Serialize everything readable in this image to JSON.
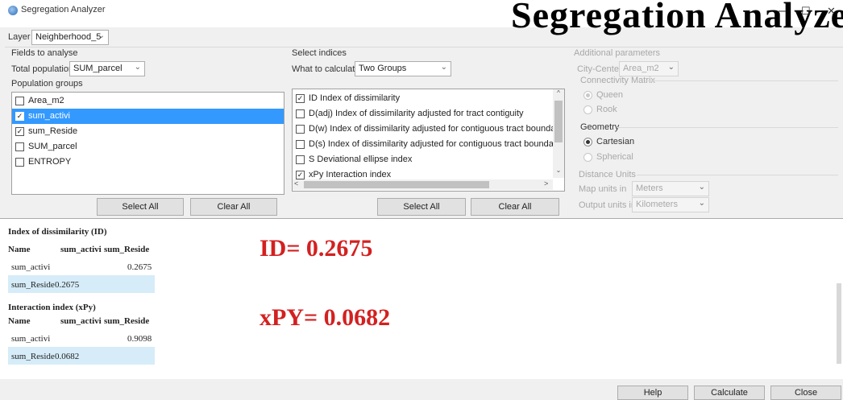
{
  "window": {
    "title": "Segregation Analyzer",
    "minimize": "–",
    "maximize": "☐",
    "close": "✕"
  },
  "heading": "Segregation Analyzer",
  "layer": {
    "label": "Layer",
    "value": "Neighberhood_5"
  },
  "fields": {
    "section_label": "Fields to analyse",
    "total_label": "Total population:",
    "total_value": "SUM_parcel",
    "groups_label": "Population groups",
    "items": [
      {
        "label": "Area_m2",
        "checked": false,
        "selected": false
      },
      {
        "label": "sum_activi",
        "checked": true,
        "selected": true
      },
      {
        "label": "sum_Reside",
        "checked": true,
        "selected": false
      },
      {
        "label": "SUM_parcel",
        "checked": false,
        "selected": false
      },
      {
        "label": "ENTROPY",
        "checked": false,
        "selected": false
      }
    ],
    "select_all": "Select All",
    "clear_all": "Clear All"
  },
  "indices": {
    "section_label": "Select indices",
    "calc_label": "What to calculate:",
    "calc_value": "Two Groups",
    "items": [
      {
        "label": "ID Index of dissimilarity",
        "checked": true
      },
      {
        "label": "D(adj) Index of dissimilarity adjusted for tract contiguity",
        "checked": false
      },
      {
        "label": "D(w) Index of dissimilarity adjusted for contiguous tract boundary lengths",
        "checked": false
      },
      {
        "label": "D(s) Index of dissimilarity adjusted for contiguous tract boundary lengths a",
        "checked": false
      },
      {
        "label": "S Deviational ellipse index",
        "checked": false
      },
      {
        "label": "xPy Interaction index",
        "checked": true
      }
    ],
    "select_all": "Select All",
    "clear_all": "Clear All"
  },
  "params": {
    "section_label": "Additional parameters",
    "city_center_label": "City-Center",
    "city_center_value": "Area_m2",
    "connectivity_label": "Connectivity Matrix",
    "queen": "Queen",
    "rook": "Rook",
    "geometry_label": "Geometry",
    "cartesian": "Cartesian",
    "spherical": "Spherical",
    "distance_label": "Distance Units",
    "map_units_label": "Map units in",
    "map_units_value": "Meters",
    "output_units_label": "Output units in",
    "output_units_value": "Kilometers"
  },
  "results": {
    "id_title": "Index of dissimilarity (ID)",
    "xpy_title": "Interaction index (xPy)",
    "col_name": "Name",
    "col_a": "sum_activi",
    "col_b": "sum_Reside",
    "id_rows": [
      {
        "name": "sum_activi",
        "a": "",
        "b": "0.2675"
      },
      {
        "name": "sum_Reside",
        "a": "0.2675",
        "b": ""
      }
    ],
    "xpy_rows": [
      {
        "name": "sum_activi",
        "a": "",
        "b": "0.9098"
      },
      {
        "name": "sum_Reside",
        "a": "0.0682",
        "b": ""
      }
    ],
    "id_big": "ID= 0.2675",
    "xpy_big": "xPY= 0.0682"
  },
  "footer": {
    "help": "Help",
    "calculate": "Calculate",
    "close": "Close"
  }
}
